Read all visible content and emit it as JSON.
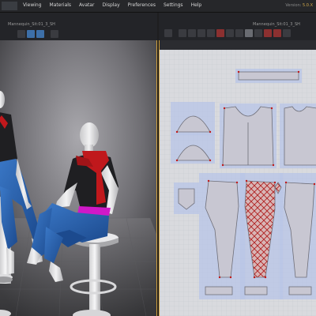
{
  "menu": {
    "items": [
      "Viewing",
      "Materials",
      "Avatar",
      "Display",
      "Preferences",
      "Settings",
      "Help"
    ],
    "version_label": "Version:",
    "version_value": "5.0.X"
  },
  "panes": {
    "left_title": "Mannequin_Sit:01_3_SH",
    "right_title": "Mannequin_Sit:01_3_SH"
  },
  "colors": {
    "accent_border": "#d4a23b",
    "shirt": "#1f1f22",
    "jeans": "#2b5fa8",
    "scarf": "#c0181c",
    "belt": "#d018c8",
    "pattern_fill": "#9aa9c8",
    "pattern_outline": "#6e8fd0"
  }
}
